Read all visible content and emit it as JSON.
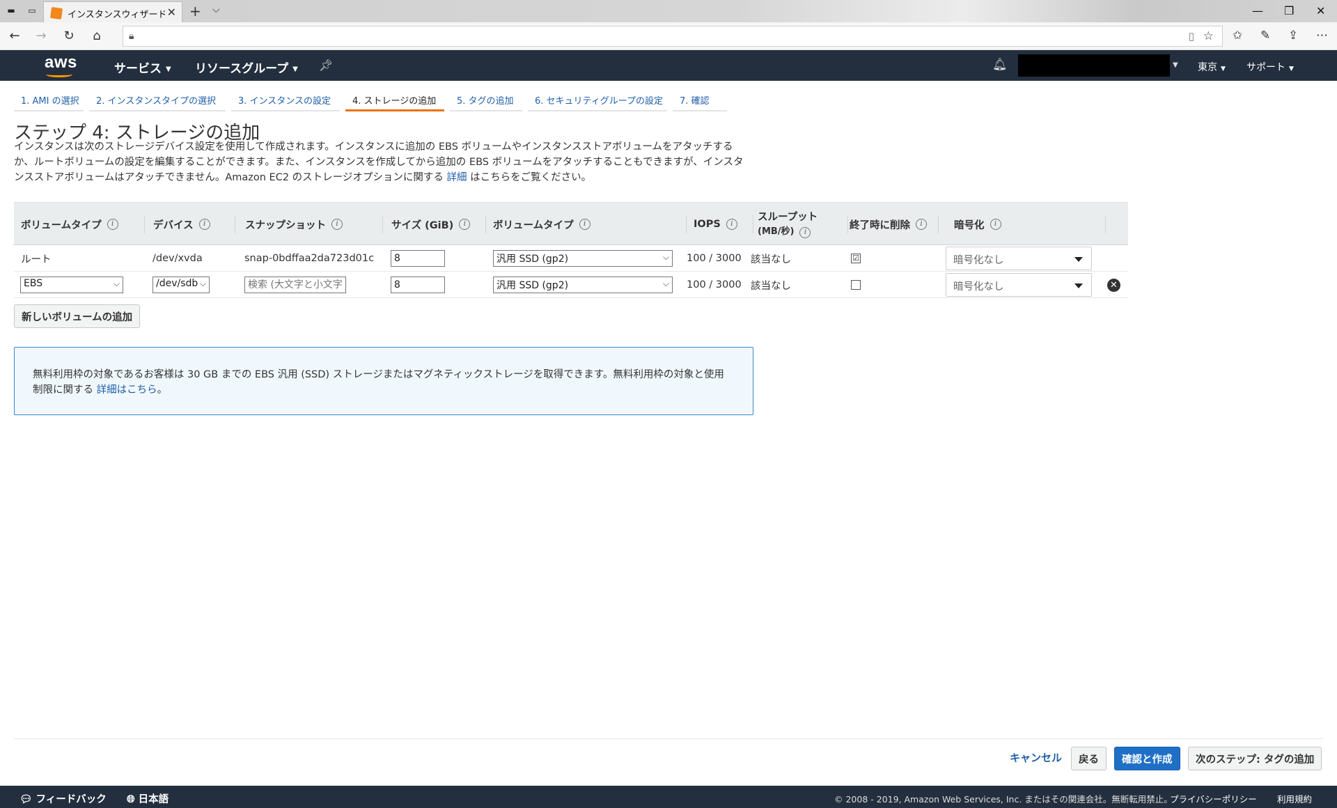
{
  "browser": {
    "tab_title": "インスタンスウィザードを起動",
    "close_glyph": "✕",
    "new_tab_glyph": "+",
    "tab_list_glyph": "⌵"
  },
  "aws_header": {
    "logo": "aws",
    "services": "サービス",
    "resource_groups": "リソースグループ",
    "region": "東京",
    "support": "サポート"
  },
  "steps": [
    "1. AMI の選択",
    "2. インスタンスタイプの選択",
    "3. インスタンスの設定",
    "4. ストレージの追加",
    "5. タグの追加",
    "6. セキュリティグループの設定",
    "7. 確認"
  ],
  "page": {
    "title": "ステップ 4: ストレージの追加",
    "intro_line1": "インスタンスは次のストレージデバイス設定を使用して作成されます。インスタンスに追加の EBS ボリュームやインスタンスストアボリュームをアタッチする",
    "intro_line2": "か、ルートボリュームの設定を編集することができます。また、インスタンスを作成してから追加の EBS ボリュームをアタッチすることもできますが、インスタ",
    "intro_line3_pre": "ンスストアボリュームはアタッチできません。Amazon EC2 のストレージオプションに関する ",
    "intro_link": "詳細",
    "intro_line3_post": " はこちらをご覧ください。"
  },
  "table": {
    "headers": {
      "volume_type": "ボリュームタイプ",
      "device": "デバイス",
      "snapshot": "スナップショット",
      "size": "サイズ (GiB)",
      "volume_kind": "ボリュームタイプ",
      "iops": "IOPS",
      "throughput_1": "スループット",
      "throughput_2": "(MB/秒)",
      "delete_on_termination": "終了時に削除",
      "encryption": "暗号化"
    },
    "rows": [
      {
        "volume_type": "ルート",
        "device": "/dev/xvda",
        "snapshot": "snap-0bdffaa2da723d01c",
        "size": "8",
        "volume_kind": "汎用 SSD (gp2)",
        "iops": "100 / 3000",
        "throughput": "該当なし",
        "delete_on_termination": "☑",
        "encryption": "暗号化なし"
      },
      {
        "volume_type": "EBS",
        "device": "/dev/sdb",
        "snapshot_placeholder": "検索 (大文字と小文字",
        "size": "8",
        "volume_kind": "汎用 SSD (gp2)",
        "iops": "100 / 3000",
        "throughput": "該当なし",
        "delete_on_termination": "",
        "encryption": "暗号化なし",
        "remove": "✕"
      }
    ]
  },
  "add_volume_button": "新しいボリュームの追加",
  "notice": {
    "line1": "無料利用枠の対象であるお客様は 30 GB までの EBS 汎用 (SSD) ストレージまたはマグネティックストレージを取得できます。無料利用枠の対象と使用",
    "line2_pre": "制限に関する ",
    "link": "詳細はこちら",
    "line2_post": "。"
  },
  "actions": {
    "cancel": "キャンセル",
    "back": "戻る",
    "review_and_launch": "確認と作成",
    "next": "次のステップ: タグの追加"
  },
  "footer": {
    "feedback": "フィードバック",
    "language": "日本語",
    "copyright": "© 2008 - 2019, Amazon Web Services, Inc. またはその関連会社。無断転用禁止。",
    "privacy": "プライバシーポリシー",
    "terms": "利用規約"
  },
  "colors": {
    "aws_header": "#232f3e",
    "accent_orange": "#ec7211",
    "link_blue": "#1f5ea8",
    "primary_button": "#1f6fc6"
  }
}
